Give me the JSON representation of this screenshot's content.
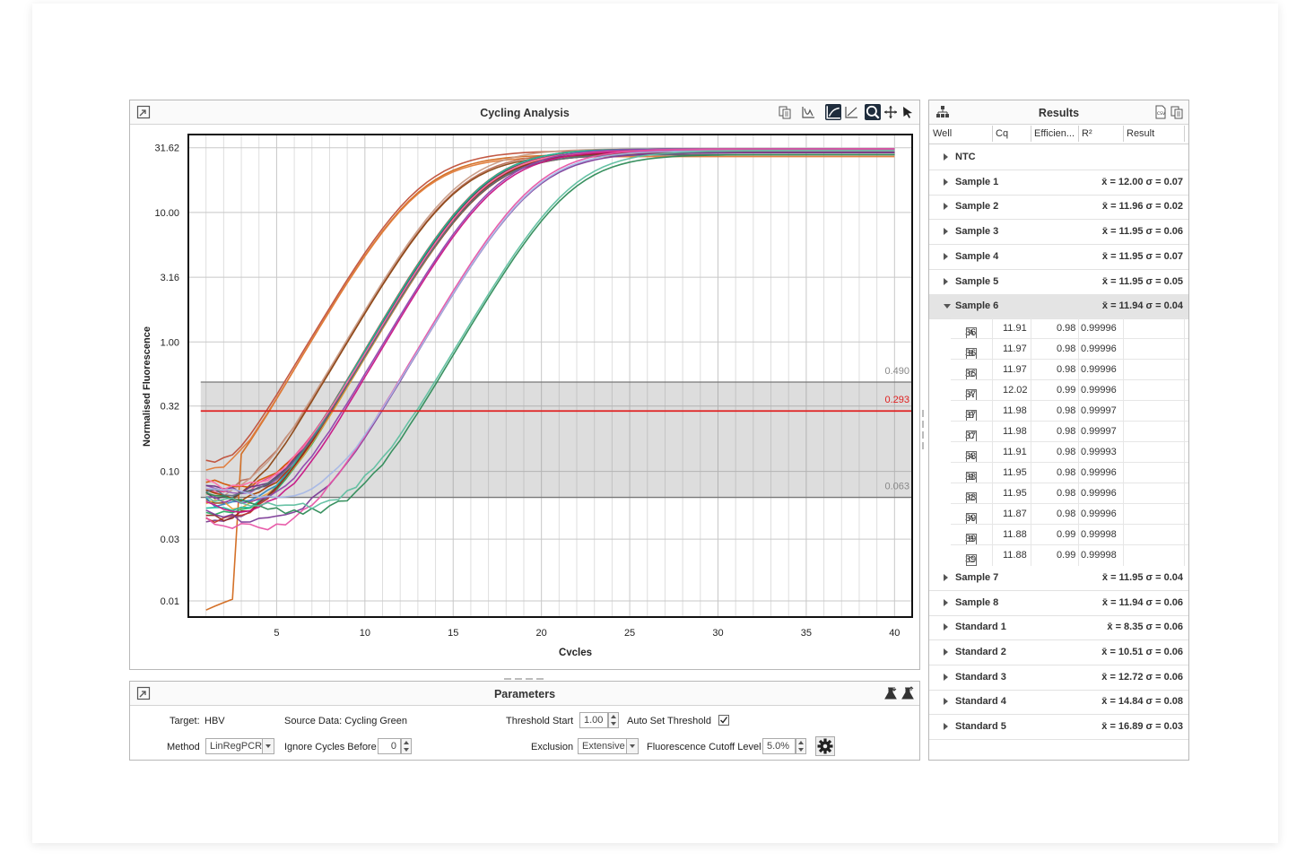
{
  "cycling": {
    "title": "Cycling Analysis",
    "threshold_upper": "0.490",
    "threshold_value": "0.293",
    "threshold_lower": "0.063"
  },
  "chart_data": {
    "type": "line",
    "xlabel": "Cycles",
    "ylabel": "Normalised Fluorescence",
    "y_scale": "log",
    "xlim": [
      0,
      41
    ],
    "ylim": [
      0.0075,
      40
    ],
    "x_ticks": [
      5,
      10,
      15,
      20,
      25,
      30,
      35,
      40
    ],
    "y_ticks": [
      {
        "value": 31.62,
        "label": "31.62"
      },
      {
        "value": 10.0,
        "label": "10.00"
      },
      {
        "value": 3.16,
        "label": "3.16"
      },
      {
        "value": 1.0,
        "label": "1.00"
      },
      {
        "value": 0.32,
        "label": "0.32"
      },
      {
        "value": 0.1,
        "label": "0.10"
      },
      {
        "value": 0.03,
        "label": "0.03"
      },
      {
        "value": 0.01,
        "label": "0.01"
      }
    ],
    "threshold": 0.293,
    "threshold_band": [
      0.063,
      0.49
    ],
    "grid": true,
    "series": [
      {
        "color": "#d2691e",
        "cq": 8.35,
        "plateau": 28
      },
      {
        "color": "#c0503a",
        "cq": 8.4,
        "plateau": 30
      },
      {
        "color": "#e07b39",
        "cq": 8.3,
        "plateau": 27
      },
      {
        "color": "#b9705a",
        "cq": 10.5,
        "plateau": 29
      },
      {
        "color": "#c89b86",
        "cq": 10.55,
        "plateau": 31
      },
      {
        "color": "#8b4513",
        "cq": 10.45,
        "plateau": 28
      },
      {
        "color": "#7b3f8f",
        "cq": 11.9,
        "plateau": 30
      },
      {
        "color": "#9b59b6",
        "cq": 11.95,
        "plateau": 29
      },
      {
        "color": "#e84c8b",
        "cq": 12.0,
        "plateau": 31
      },
      {
        "color": "#4d4d4d",
        "cq": 11.9,
        "plateau": 30
      },
      {
        "color": "#2e86c1",
        "cq": 11.97,
        "plateau": 28
      },
      {
        "color": "#27ae60",
        "cq": 12.02,
        "plateau": 29
      },
      {
        "color": "#c0392b",
        "cq": 11.88,
        "plateau": 31
      },
      {
        "color": "#d35400",
        "cq": 12.05,
        "plateau": 30
      },
      {
        "color": "#6c3483",
        "cq": 11.93,
        "plateau": 29
      },
      {
        "color": "#a04000",
        "cq": 11.98,
        "plateau": 28
      },
      {
        "color": "#e6a23c",
        "cq": 12.1,
        "plateau": 30
      },
      {
        "color": "#1abc9c",
        "cq": 11.91,
        "plateau": 31
      },
      {
        "color": "#922b21",
        "cq": 11.96,
        "plateau": 29
      },
      {
        "color": "#ff6fa8",
        "cq": 12.0,
        "plateau": 30
      },
      {
        "color": "#5d6d7e",
        "cq": 11.94,
        "plateau": 28
      },
      {
        "color": "#8e44ad",
        "cq": 12.72,
        "plateau": 31
      },
      {
        "color": "#c71585",
        "cq": 12.75,
        "plateau": 30
      },
      {
        "color": "#7d3c98",
        "cq": 14.84,
        "plateau": 29
      },
      {
        "color": "#e754a5",
        "cq": 14.86,
        "plateau": 31
      },
      {
        "color": "#a5b7e6",
        "cq": 14.9,
        "plateau": 30
      },
      {
        "color": "#2e8b57",
        "cq": 16.89,
        "plateau": 28
      },
      {
        "color": "#5fbfa0",
        "cq": 16.92,
        "plateau": 30
      }
    ]
  },
  "results": {
    "title": "Results",
    "columns": [
      "Well",
      "Cq",
      "Efficien...",
      "R²",
      "Result"
    ],
    "groups_before": [
      {
        "name": "NTC",
        "stats": ""
      },
      {
        "name": "Sample 1",
        "stats": "x̄ = 12.00 σ = 0.07"
      },
      {
        "name": "Sample 2",
        "stats": "x̄ = 11.96 σ = 0.02"
      },
      {
        "name": "Sample 3",
        "stats": "x̄ = 11.95 σ = 0.06"
      },
      {
        "name": "Sample 4",
        "stats": "x̄ = 11.95 σ = 0.07"
      },
      {
        "name": "Sample 5",
        "stats": "x̄ = 11.95 σ = 0.05"
      }
    ],
    "expanded": {
      "name": "Sample 6",
      "stats": "x̄ = 11.94 σ = 0.04"
    },
    "wells": [
      {
        "well": "36",
        "rep": "A",
        "cq": "11.91",
        "eff": "0.98",
        "r2": "0.99996"
      },
      {
        "well": "36",
        "rep": "B",
        "cq": "11.97",
        "eff": "0.98",
        "r2": "0.99996"
      },
      {
        "well": "36",
        "rep": "C",
        "cq": "11.97",
        "eff": "0.98",
        "r2": "0.99996"
      },
      {
        "well": "37",
        "rep": "A",
        "cq": "12.02",
        "eff": "0.99",
        "r2": "0.99996"
      },
      {
        "well": "37",
        "rep": "B",
        "cq": "11.98",
        "eff": "0.98",
        "r2": "0.99997"
      },
      {
        "well": "37",
        "rep": "C",
        "cq": "11.98",
        "eff": "0.98",
        "r2": "0.99997"
      },
      {
        "well": "38",
        "rep": "A",
        "cq": "11.91",
        "eff": "0.98",
        "r2": "0.99993"
      },
      {
        "well": "38",
        "rep": "B",
        "cq": "11.95",
        "eff": "0.98",
        "r2": "0.99996"
      },
      {
        "well": "38",
        "rep": "C",
        "cq": "11.95",
        "eff": "0.98",
        "r2": "0.99996"
      },
      {
        "well": "39",
        "rep": "A",
        "cq": "11.87",
        "eff": "0.98",
        "r2": "0.99996"
      },
      {
        "well": "39",
        "rep": "B",
        "cq": "11.88",
        "eff": "0.99",
        "r2": "0.99998"
      },
      {
        "well": "39",
        "rep": "C",
        "cq": "11.88",
        "eff": "0.99",
        "r2": "0.99998"
      }
    ],
    "groups_after": [
      {
        "name": "Sample 7",
        "stats": "x̄ = 11.95 σ = 0.04"
      },
      {
        "name": "Sample 8",
        "stats": "x̄ = 11.94 σ = 0.06"
      },
      {
        "name": "Standard 1",
        "stats": "x̄ = 8.35 σ = 0.06"
      },
      {
        "name": "Standard 2",
        "stats": "x̄ = 10.51 σ = 0.06"
      },
      {
        "name": "Standard 3",
        "stats": "x̄ = 12.72 σ = 0.06"
      },
      {
        "name": "Standard 4",
        "stats": "x̄ = 14.84 σ = 0.08"
      },
      {
        "name": "Standard 5",
        "stats": "x̄ = 16.89 σ = 0.03"
      }
    ]
  },
  "params": {
    "title": "Parameters",
    "target_label": "Target:",
    "target_value": "HBV",
    "source_label": "Source Data: Cycling Green",
    "threshold_start_label": "Threshold Start",
    "threshold_start_value": "1.00",
    "auto_set_label": "Auto Set Threshold",
    "auto_set_checked": true,
    "method_label": "Method",
    "method_value": "LinRegPCR",
    "ignore_label": "Ignore Cycles Before",
    "ignore_value": "0",
    "exclusion_label": "Exclusion",
    "exclusion_value": "Extensive",
    "cutoff_label": "Fluorescence Cutoff Level",
    "cutoff_value": "5.0%"
  },
  "icons": {
    "popout": "popout-icon",
    "copy": "copy-icon",
    "line_chart": "line-chart-icon",
    "log_scale": "log-scale-icon",
    "linear_scale": "linear-scale-icon",
    "zoom": "zoom-icon",
    "pan": "pan-icon",
    "pointer": "pointer-icon",
    "settings": "gear-icon"
  }
}
